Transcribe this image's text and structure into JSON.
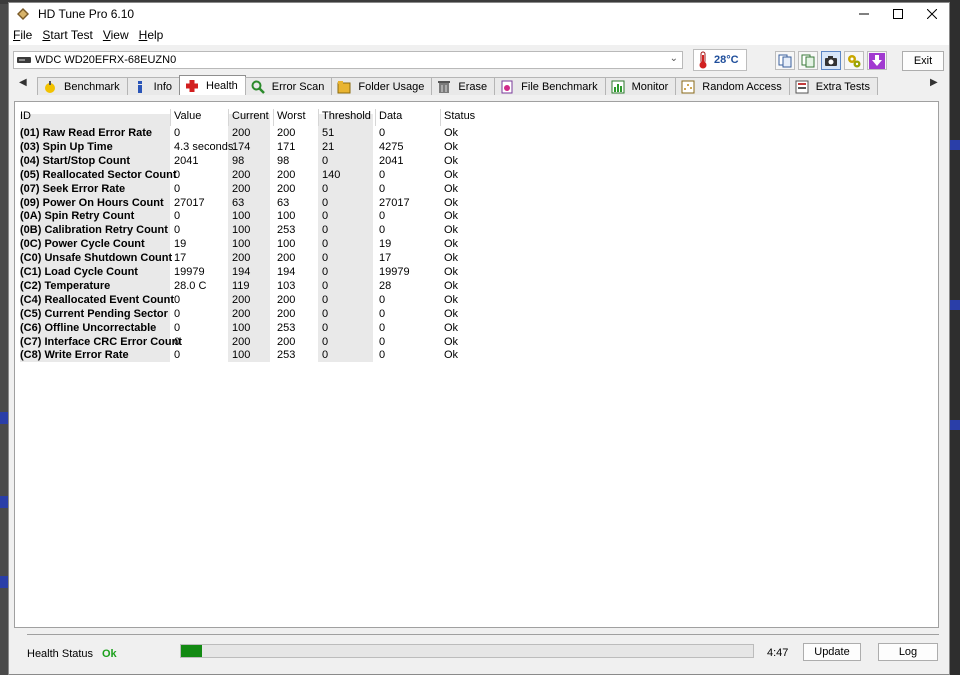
{
  "window": {
    "title": "HD Tune Pro 6.10"
  },
  "menu": [
    {
      "pre": "",
      "acc": "F",
      "post": "ile"
    },
    {
      "pre": "",
      "acc": "S",
      "post": "tart Test"
    },
    {
      "pre": "",
      "acc": "V",
      "post": "iew"
    },
    {
      "pre": "",
      "acc": "H",
      "post": "elp"
    }
  ],
  "toolbar": {
    "drive": "WDC WD20EFRX-68EUZN0",
    "temperature": "28°C",
    "exit_label": "Exit"
  },
  "tabs": [
    {
      "label": "Benchmark",
      "icon": "benchmark-icon"
    },
    {
      "label": "Info",
      "icon": "info-icon"
    },
    {
      "label": "Health",
      "icon": "health-icon",
      "active": true
    },
    {
      "label": "Error Scan",
      "icon": "error-scan-icon"
    },
    {
      "label": "Folder Usage",
      "icon": "folder-usage-icon"
    },
    {
      "label": "Erase",
      "icon": "erase-icon"
    },
    {
      "label": "File Benchmark",
      "icon": "file-benchmark-icon"
    },
    {
      "label": "Monitor",
      "icon": "monitor-icon"
    },
    {
      "label": "Random Access",
      "icon": "random-access-icon"
    },
    {
      "label": "Extra Tests",
      "icon": "extra-tests-icon"
    }
  ],
  "table": {
    "headers": [
      "ID",
      "Value",
      "Current",
      "Worst",
      "Threshold",
      "Data",
      "Status"
    ],
    "rows": [
      [
        "(01) Raw Read Error Rate",
        "0",
        "200",
        "200",
        "51",
        "0",
        "Ok"
      ],
      [
        "(03) Spin Up Time",
        "4.3 seconds",
        "174",
        "171",
        "21",
        "4275",
        "Ok"
      ],
      [
        "(04) Start/Stop Count",
        "2041",
        "98",
        "98",
        "0",
        "2041",
        "Ok"
      ],
      [
        "(05) Reallocated Sector Count",
        "0",
        "200",
        "200",
        "140",
        "0",
        "Ok"
      ],
      [
        "(07) Seek Error Rate",
        "0",
        "200",
        "200",
        "0",
        "0",
        "Ok"
      ],
      [
        "(09) Power On Hours Count",
        "27017",
        "63",
        "63",
        "0",
        "27017",
        "Ok"
      ],
      [
        "(0A) Spin Retry Count",
        "0",
        "100",
        "100",
        "0",
        "0",
        "Ok"
      ],
      [
        "(0B) Calibration Retry Count",
        "0",
        "100",
        "253",
        "0",
        "0",
        "Ok"
      ],
      [
        "(0C) Power Cycle Count",
        "19",
        "100",
        "100",
        "0",
        "19",
        "Ok"
      ],
      [
        "(C0) Unsafe Shutdown Count",
        "17",
        "200",
        "200",
        "0",
        "17",
        "Ok"
      ],
      [
        "(C1) Load Cycle Count",
        "19979",
        "194",
        "194",
        "0",
        "19979",
        "Ok"
      ],
      [
        "(C2) Temperature",
        "28.0 C",
        "119",
        "103",
        "0",
        "28",
        "Ok"
      ],
      [
        "(C4) Reallocated Event Count",
        "0",
        "200",
        "200",
        "0",
        "0",
        "Ok"
      ],
      [
        "(C5) Current Pending Sector",
        "0",
        "200",
        "200",
        "0",
        "0",
        "Ok"
      ],
      [
        "(C6) Offline Uncorrectable",
        "0",
        "100",
        "253",
        "0",
        "0",
        "Ok"
      ],
      [
        "(C7) Interface CRC Error Count",
        "0",
        "200",
        "200",
        "0",
        "0",
        "Ok"
      ],
      [
        "(C8) Write Error Rate",
        "0",
        "100",
        "253",
        "0",
        "0",
        "Ok"
      ]
    ]
  },
  "status": {
    "label": "Health Status",
    "value": "Ok",
    "progress_fraction": 0.037,
    "time": "4:47",
    "update_label": "Update",
    "log_label": "Log"
  },
  "colors": {
    "ok_green": "#1da11d",
    "progress_green": "#138a13",
    "temp_blue": "#1f4e9b"
  }
}
